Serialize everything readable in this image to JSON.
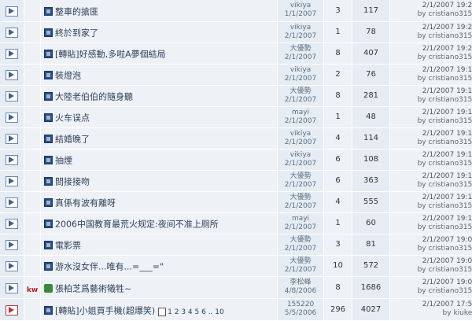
{
  "topics": [
    {
      "title": "整車的搶匪",
      "author": "vikiya",
      "author_date": "1/1/2007",
      "replies": "3",
      "views": "117",
      "last_date": "2/1/2007 19:23",
      "last_by": "by cristiano3156"
    },
    {
      "title": "終於到家了",
      "author": "vikiya",
      "author_date": "2/1/2007",
      "replies": "1",
      "views": "78",
      "last_date": "2/1/2007 19:21",
      "last_by": "by cristiano3156"
    },
    {
      "title": "[轉貼]好感動,多啦A夢個結局",
      "author": "大優勢",
      "author_date": "2/1/2007",
      "replies": "8",
      "views": "407",
      "last_date": "2/1/2007 19:20",
      "last_by": "by cristiano3156"
    },
    {
      "title": "裝燈泡",
      "author": "vikiya",
      "author_date": "2/1/2007",
      "replies": "2",
      "views": "76",
      "last_date": "2/1/2007 19:19",
      "last_by": "by cristiano3156"
    },
    {
      "title": "大陸老伯伯的隨身聽",
      "author": "大優勢",
      "author_date": "2/1/2007",
      "replies": "8",
      "views": "281",
      "last_date": "2/1/2007 19:18",
      "last_by": "by cristiano3156"
    },
    {
      "title": "火车误点",
      "author": "mayi",
      "author_date": "2/1/2007",
      "replies": "1",
      "views": "48",
      "last_date": "2/1/2007 19:16",
      "last_by": "by cristiano3156"
    },
    {
      "title": "結婚晚了",
      "author": "vikiya",
      "author_date": "2/1/2007",
      "replies": "4",
      "views": "114",
      "last_date": "2/1/2007 19:14",
      "last_by": "by cristiano3156"
    },
    {
      "title": "抽煙",
      "author": "vikiya",
      "author_date": "2/1/2007",
      "replies": "6",
      "views": "108",
      "last_date": "2/1/2007 19:13",
      "last_by": "by cristiano3156"
    },
    {
      "title": "間接接吻",
      "author": "大優勢",
      "author_date": "2/1/2007",
      "replies": "6",
      "views": "363",
      "last_date": "2/1/2007 19:11",
      "last_by": "by cristiano3156"
    },
    {
      "title": "真係有波有離呀",
      "author": "大優勢",
      "author_date": "2/1/2007",
      "replies": "4",
      "views": "555",
      "last_date": "2/1/2007 19:11",
      "last_by": "by cristiano3156"
    },
    {
      "title": "2006中国教育最荒火规定:夜间不准上厕所",
      "author": "mayi",
      "author_date": "2/1/2007",
      "replies": "1",
      "views": "60",
      "last_date": "2/1/2007 19:10",
      "last_by": "by cristiano3156"
    },
    {
      "title": "電影票",
      "author": "大優勢",
      "author_date": "2/1/2007",
      "replies": "3",
      "views": "81",
      "last_date": "2/1/2007 19:09",
      "last_by": "by cristiano3156"
    },
    {
      "title": "游水沒女伴...唯有...=___=\"",
      "author": "大優勢",
      "author_date": "2/1/2007",
      "replies": "10",
      "views": "572",
      "last_date": "2/1/2007 19:02",
      "last_by": "by cristiano3156"
    },
    {
      "title": "張柏芝爲藝術犧牲~",
      "author": "李松峰",
      "author_date": "4/8/2006",
      "replies": "8",
      "views": "1686",
      "last_date": "2/1/2007 19:01",
      "last_by": "by cristiano3156",
      "emo": "kw"
    },
    {
      "title": "[轉貼]小姐買手機(超爆笑)",
      "author": "155220",
      "author_date": "5/5/2006",
      "replies": "296",
      "views": "4027",
      "last_date": "2/1/2007 17:57",
      "last_by": "by kiuken",
      "pages": "1 2 3 4 5 6 .. 10"
    }
  ]
}
